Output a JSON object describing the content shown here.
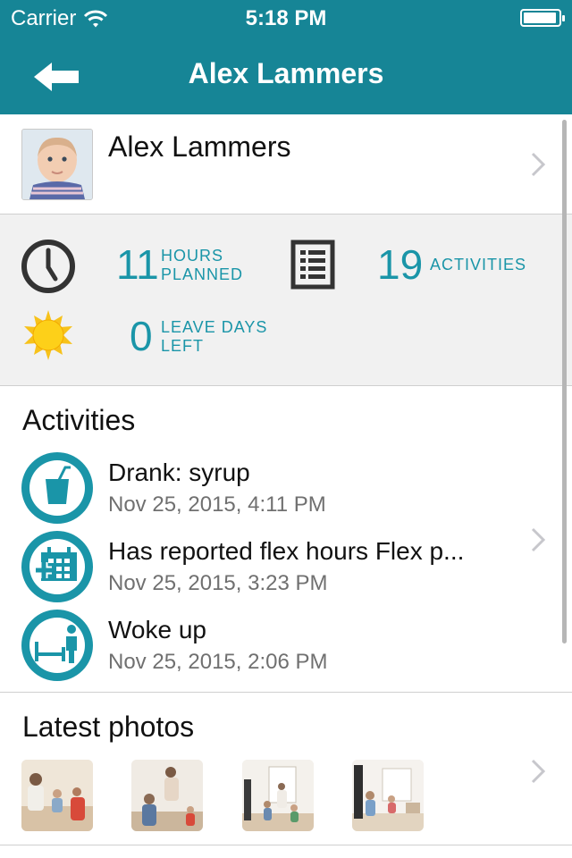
{
  "status_bar": {
    "carrier": "Carrier",
    "time": "5:18 PM"
  },
  "nav": {
    "title": "Alex Lammers",
    "back_icon": "arrow-left-icon"
  },
  "profile": {
    "name": "Alex Lammers"
  },
  "stats": {
    "hours": {
      "value": "11",
      "label_line1": "HOURS",
      "label_line2": "PLANNED",
      "icon": "clock-icon"
    },
    "activities": {
      "value": "19",
      "label": "ACTIVITIES",
      "icon": "list-icon"
    },
    "leave": {
      "value": "0",
      "label_line1": "LEAVE DAYS",
      "label_line2": "LEFT",
      "icon": "sun-icon"
    }
  },
  "activities": {
    "title": "Activities",
    "items": [
      {
        "title": "Drank: syrup",
        "time": "Nov 25, 2015, 4:11 PM",
        "icon": "drink-icon"
      },
      {
        "title": "Has reported flex hours Flex p...",
        "time": "Nov 25, 2015, 3:23 PM",
        "icon": "calendar-plus-icon"
      },
      {
        "title": "Woke up",
        "time": "Nov 25, 2015, 2:06 PM",
        "icon": "bed-icon"
      }
    ]
  },
  "photos": {
    "title": "Latest photos"
  },
  "colors": {
    "accent": "#168596",
    "accent_text": "#1a95a8",
    "stats_bg": "#f1f1f1"
  }
}
